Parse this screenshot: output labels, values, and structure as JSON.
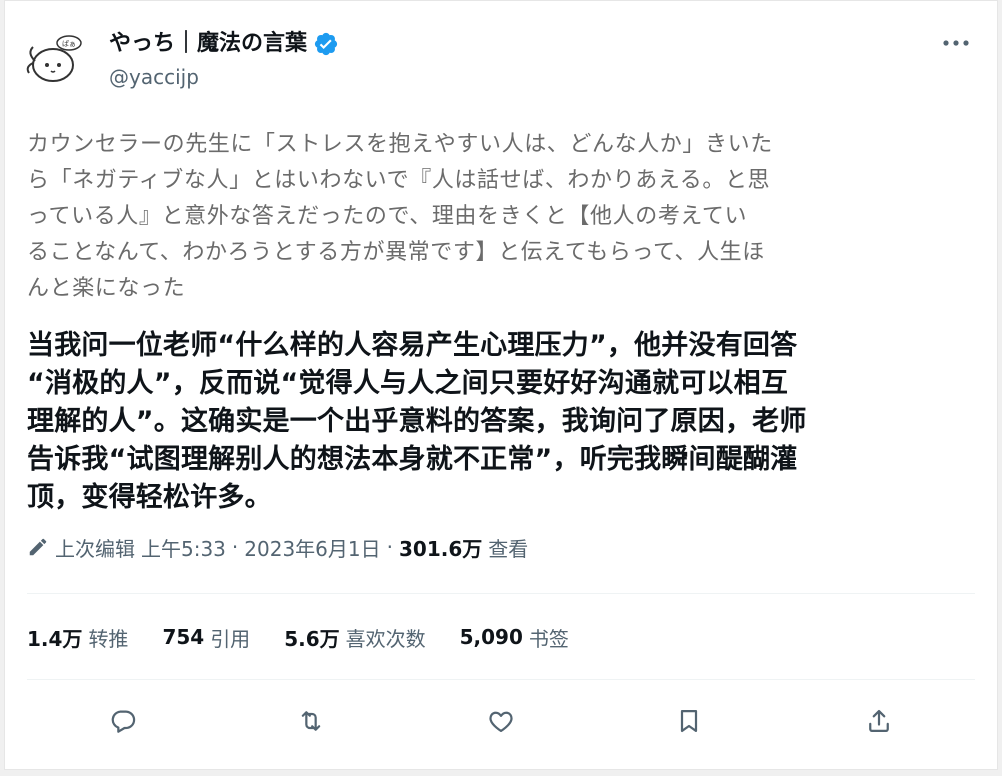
{
  "tweet": {
    "author": {
      "display_name": "やっち｜魔法の言葉",
      "handle": "@yaccijp",
      "avatar_badge_text": "ぱぁ"
    },
    "original_text": "カウンセラーの先生に「ストレスを抱えやすい人は、どんな人か」きいた\nら「ネガティブな人」とはいわないで『人は話せば、わかりあえる。と思\nっている人』と意外な答えだったので、理由をきくと【他人の考えてい\nることなんて、わかろうとする方が異常です】と伝えてもらって、人生ほ\nんと楽になった",
    "translation_text": "当我问一位老师“什么样的人容易产生心理压力”，他并没有回答\n“消极的人”，反而说“觉得人与人之间只要好好沟通就可以相互\n理解的人”。这确实是一个出乎意料的答案，我询问了原因，老师\n告诉我“试图理解别人的想法本身就不正常”，听完我瞬间醍醐灌\n顶，变得轻松许多。",
    "meta": {
      "edited_label": "上次编辑",
      "time": "上午5:33",
      "separator": "·",
      "date": "2023年6月1日",
      "views_count": "301.6万",
      "views_label": "查看"
    },
    "stats": {
      "retweets_count": "1.4万",
      "retweets_label": "转推",
      "quotes_count": "754",
      "quotes_label": "引用",
      "likes_count": "5.6万",
      "likes_label": "喜欢次数",
      "bookmarks_count": "5,090",
      "bookmarks_label": "书签"
    }
  },
  "icons": {
    "verified": "verified-badge-icon",
    "more": "more-dots-icon",
    "edit": "pencil-icon",
    "reply": "reply-bubble-icon",
    "retweet": "retweet-icon",
    "like": "heart-icon",
    "bookmark": "bookmark-icon",
    "share": "share-icon"
  },
  "colors": {
    "verified_blue": "#1d9bf0",
    "secondary_text": "#536471",
    "primary_text": "#0f1419",
    "original_text_gray": "#6b6b6b"
  }
}
